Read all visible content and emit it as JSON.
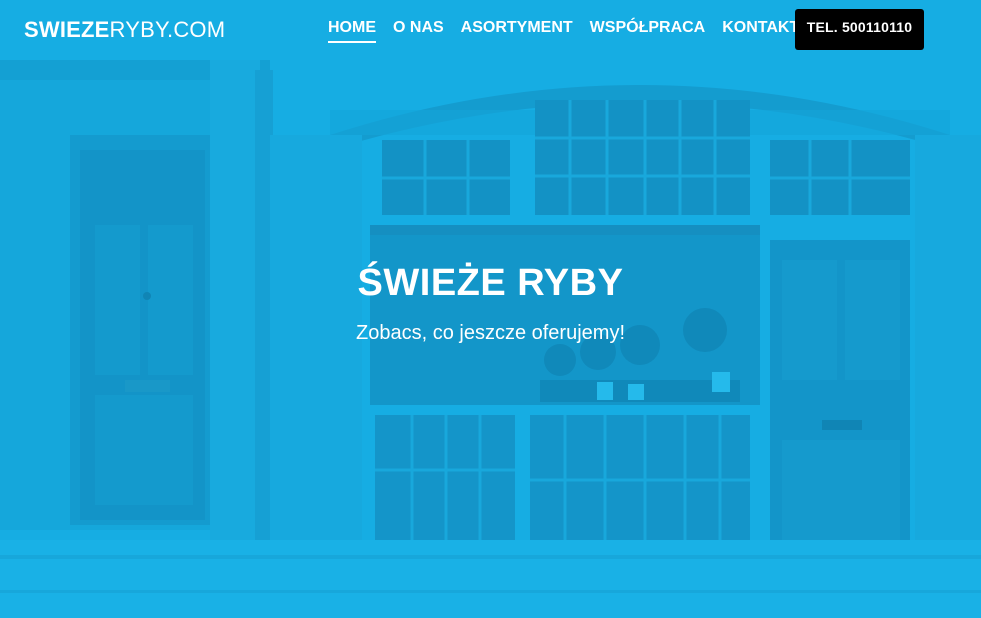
{
  "brand": {
    "part_bold": "SWIEZE",
    "part_regular": "RYBY.COM"
  },
  "nav": {
    "items": [
      {
        "label": "HOME",
        "active": true
      },
      {
        "label": "O NAS",
        "active": false
      },
      {
        "label": "ASORTYMENT",
        "active": false
      },
      {
        "label": "WSPÓŁPRACA",
        "active": false
      },
      {
        "label": "KONTAKT",
        "active": false
      }
    ],
    "phone_button": "TEL. 500110110"
  },
  "hero": {
    "title": "ŚWIEŻE RYBY",
    "subtitle": "Zobacs, co jeszcze oferujemy!"
  },
  "colors": {
    "overlay_blue": "#14b0e6",
    "text": "#ffffff",
    "phone_button_bg": "#000000"
  }
}
